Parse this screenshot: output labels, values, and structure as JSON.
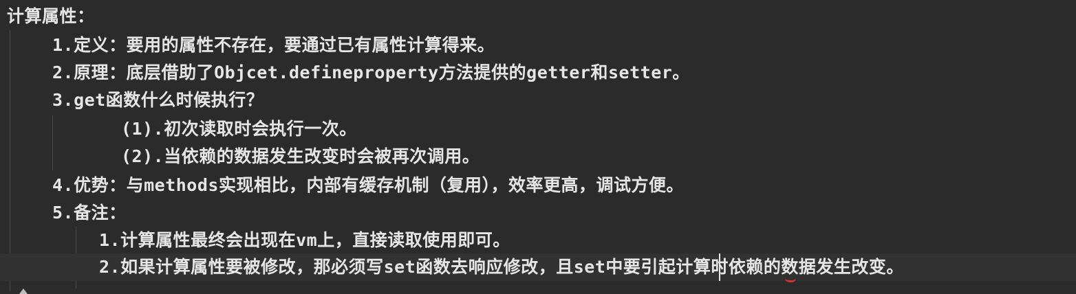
{
  "editor": {
    "lines": [
      "计算属性：",
      "1.定义：要用的属性不存在，要通过已有属性计算得来。",
      "2.原理：底层借助了Objcet.defineproperty方法提供的getter和setter。",
      "3.get函数什么时候执行？",
      "(1).初次读取时会执行一次。",
      "(2).当依赖的数据发生改变时会被再次调用。",
      "4.优势：与methods实现相比，内部有缓存机制（复用），效率更高，调试方便。",
      "5.备注：",
      "1.计算属性最终会出现在vm上，直接读取使用即可。",
      "2.如果计算属性要被修改，那必须写set函数去响应修改，且set中要引起计算时依赖的数据发生改变。"
    ]
  }
}
